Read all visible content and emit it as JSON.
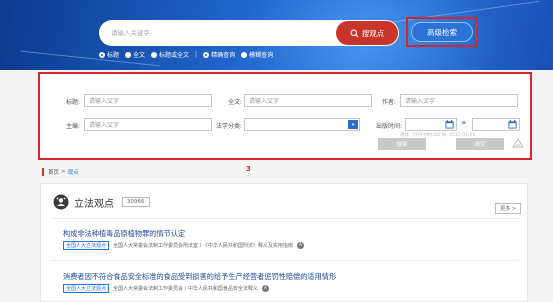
{
  "search": {
    "placeholder": "请输入关键字",
    "button_label": "搜观点",
    "advanced_label": "高级检索",
    "options": [
      {
        "label": "标题",
        "checked": true
      },
      {
        "label": "全文",
        "checked": false
      },
      {
        "label": "标题或全文",
        "checked": false
      },
      {
        "label": "精确查询",
        "checked": true
      },
      {
        "label": "模糊查询",
        "checked": false
      }
    ],
    "separator": "|"
  },
  "advanced": {
    "title_label": "标题:",
    "title_placeholder": "请输入文字",
    "fulltext_label": "全文:",
    "fulltext_placeholder": "请输入文字",
    "author_label": "作者:",
    "author_placeholder": "请输入文字",
    "editor_label": "主编:",
    "editor_placeholder": "请输入文字",
    "category_label": "法学分类:",
    "date_label": "出版时间:",
    "date_range_arrow": "»",
    "date_hint": "格式: YYYY-MM-DD  如: 2015-01-01",
    "search_button": "搜索",
    "clear_button": "清空"
  },
  "annotation": "3",
  "breadcrumb": {
    "home": "首页",
    "separator": ">",
    "current": "观点"
  },
  "section": {
    "icon": "opinion-icon",
    "title": "立法观点",
    "count": "30966",
    "more": "更多 >"
  },
  "items": [
    {
      "title": "构成非法种植毒品原植物罪的情节认定",
      "tag": "全国人大立法观点",
      "meta": "全国人大常委会法制工作委员会刑法室 / 《中华人民共和国刑法》释义及实用指南",
      "badge": "A"
    },
    {
      "title": "消费者因不符合食品安全标准的食品受到损害的给予生产经营者惩罚性赔偿的适用情形",
      "tag": "全国人大立法观点",
      "meta": "全国人大常委会法制工作委员会 / 中华人民共和国食品安全法释义",
      "badge": "A"
    }
  ],
  "colors": {
    "accent_red": "#d3272f",
    "brand_blue": "#2b73d6"
  }
}
